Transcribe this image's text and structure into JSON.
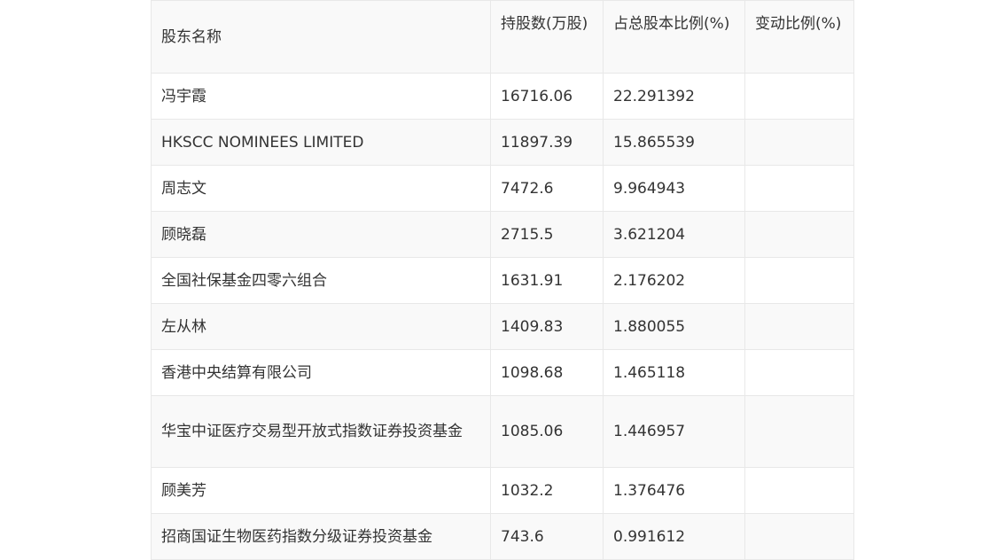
{
  "table": {
    "headers": [
      "股东名称",
      "持股数(万股)",
      "占总股本比例(%)",
      "变动比例(%)"
    ],
    "rows": [
      {
        "name": "冯宇霞",
        "shares": "16716.06",
        "ratio": "22.291392",
        "change": ""
      },
      {
        "name": "HKSCC NOMINEES LIMITED",
        "shares": "11897.39",
        "ratio": "15.865539",
        "change": ""
      },
      {
        "name": "周志文",
        "shares": "7472.6",
        "ratio": "9.964943",
        "change": ""
      },
      {
        "name": "顾晓磊",
        "shares": "2715.5",
        "ratio": "3.621204",
        "change": ""
      },
      {
        "name": "全国社保基金四零六组合",
        "shares": "1631.91",
        "ratio": "2.176202",
        "change": ""
      },
      {
        "name": "左从林",
        "shares": "1409.83",
        "ratio": "1.880055",
        "change": ""
      },
      {
        "name": "香港中央结算有限公司",
        "shares": "1098.68",
        "ratio": "1.465118",
        "change": ""
      },
      {
        "name": "华宝中证医疗交易型开放式指数证券投资基金",
        "shares": "1085.06",
        "ratio": "1.446957",
        "change": ""
      },
      {
        "name": "顾美芳",
        "shares": "1032.2",
        "ratio": "1.376476",
        "change": ""
      },
      {
        "name": "招商国证生物医药指数分级证券投资基金",
        "shares": "743.6",
        "ratio": "0.991612",
        "change": ""
      }
    ]
  }
}
